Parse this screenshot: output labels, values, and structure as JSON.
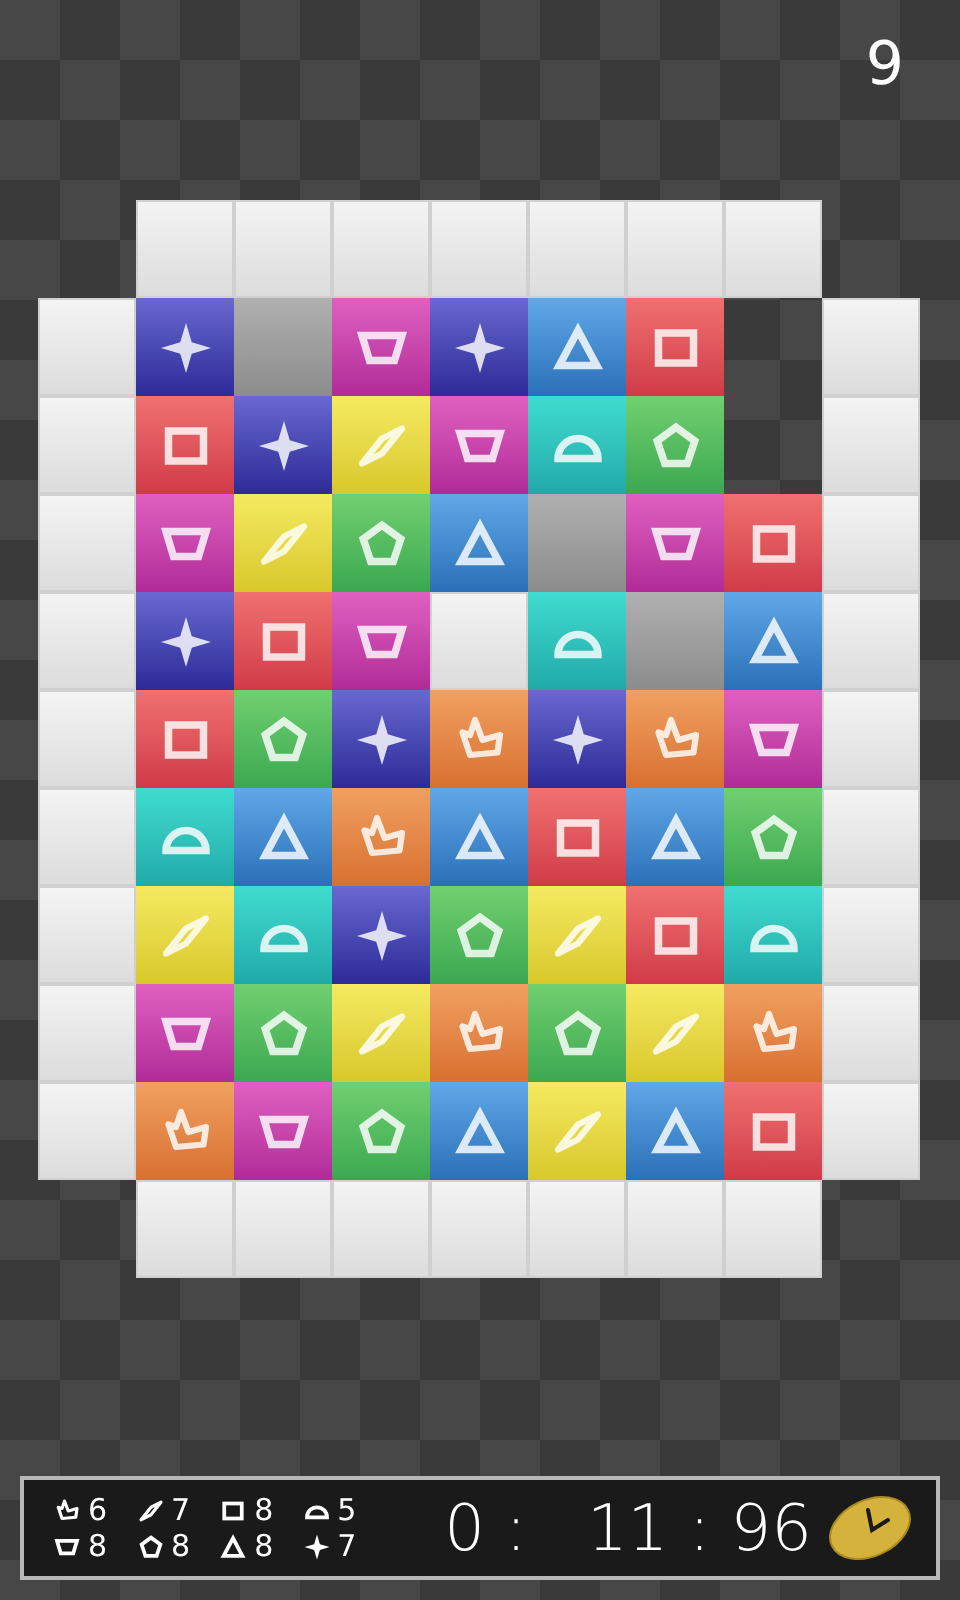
{
  "score": "9",
  "board": {
    "rows": [
      [
        {
          "kind": "empty"
        },
        {
          "kind": "wall"
        },
        {
          "kind": "wall"
        },
        {
          "kind": "wall"
        },
        {
          "kind": "wall"
        },
        {
          "kind": "wall"
        },
        {
          "kind": "wall"
        },
        {
          "kind": "wall"
        },
        {
          "kind": "empty"
        }
      ],
      [
        {
          "kind": "wall"
        },
        {
          "kind": "star"
        },
        {
          "kind": "blank"
        },
        {
          "kind": "trapezoid"
        },
        {
          "kind": "star"
        },
        {
          "kind": "triangle"
        },
        {
          "kind": "square"
        },
        {
          "kind": "empty"
        },
        {
          "kind": "wall"
        }
      ],
      [
        {
          "kind": "wall"
        },
        {
          "kind": "square"
        },
        {
          "kind": "star"
        },
        {
          "kind": "parallelogram"
        },
        {
          "kind": "trapezoid"
        },
        {
          "kind": "arch"
        },
        {
          "kind": "pentagon"
        },
        {
          "kind": "empty"
        },
        {
          "kind": "wall"
        }
      ],
      [
        {
          "kind": "wall"
        },
        {
          "kind": "trapezoid"
        },
        {
          "kind": "parallelogram"
        },
        {
          "kind": "pentagon"
        },
        {
          "kind": "triangle"
        },
        {
          "kind": "blank"
        },
        {
          "kind": "trapezoid"
        },
        {
          "kind": "square"
        },
        {
          "kind": "wall"
        }
      ],
      [
        {
          "kind": "wall"
        },
        {
          "kind": "star"
        },
        {
          "kind": "square"
        },
        {
          "kind": "trapezoid"
        },
        {
          "kind": "wall"
        },
        {
          "kind": "arch"
        },
        {
          "kind": "blank"
        },
        {
          "kind": "triangle"
        },
        {
          "kind": "wall"
        }
      ],
      [
        {
          "kind": "wall"
        },
        {
          "kind": "square"
        },
        {
          "kind": "pentagon"
        },
        {
          "kind": "star"
        },
        {
          "kind": "hook"
        },
        {
          "kind": "star"
        },
        {
          "kind": "hook"
        },
        {
          "kind": "trapezoid"
        },
        {
          "kind": "wall"
        }
      ],
      [
        {
          "kind": "wall"
        },
        {
          "kind": "arch"
        },
        {
          "kind": "triangle"
        },
        {
          "kind": "hook"
        },
        {
          "kind": "triangle"
        },
        {
          "kind": "square"
        },
        {
          "kind": "triangle"
        },
        {
          "kind": "pentagon"
        },
        {
          "kind": "wall"
        }
      ],
      [
        {
          "kind": "wall"
        },
        {
          "kind": "parallelogram"
        },
        {
          "kind": "arch"
        },
        {
          "kind": "star"
        },
        {
          "kind": "pentagon"
        },
        {
          "kind": "parallelogram"
        },
        {
          "kind": "square"
        },
        {
          "kind": "arch"
        },
        {
          "kind": "wall"
        }
      ],
      [
        {
          "kind": "wall"
        },
        {
          "kind": "trapezoid"
        },
        {
          "kind": "pentagon"
        },
        {
          "kind": "parallelogram"
        },
        {
          "kind": "hook"
        },
        {
          "kind": "pentagon"
        },
        {
          "kind": "parallelogram"
        },
        {
          "kind": "hook"
        },
        {
          "kind": "wall"
        }
      ],
      [
        {
          "kind": "wall"
        },
        {
          "kind": "hook"
        },
        {
          "kind": "trapezoid"
        },
        {
          "kind": "pentagon"
        },
        {
          "kind": "triangle"
        },
        {
          "kind": "parallelogram"
        },
        {
          "kind": "triangle"
        },
        {
          "kind": "square"
        },
        {
          "kind": "wall"
        }
      ],
      [
        {
          "kind": "empty"
        },
        {
          "kind": "wall"
        },
        {
          "kind": "wall"
        },
        {
          "kind": "wall"
        },
        {
          "kind": "wall"
        },
        {
          "kind": "wall"
        },
        {
          "kind": "wall"
        },
        {
          "kind": "wall"
        },
        {
          "kind": "empty"
        }
      ]
    ]
  },
  "counters": [
    {
      "kind": "hook",
      "count": "6"
    },
    {
      "kind": "trapezoid",
      "count": "8"
    },
    {
      "kind": "parallelogram",
      "count": "7"
    },
    {
      "kind": "pentagon",
      "count": "8"
    },
    {
      "kind": "square",
      "count": "8"
    },
    {
      "kind": "triangle",
      "count": "8"
    },
    {
      "kind": "arch",
      "count": "5"
    },
    {
      "kind": "star",
      "count": "7"
    }
  ],
  "timer": {
    "minutes": "0 :",
    "seconds": "11 : 96"
  }
}
